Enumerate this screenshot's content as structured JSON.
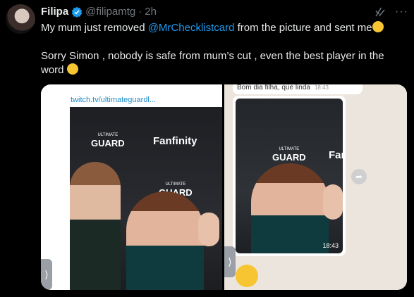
{
  "tweet": {
    "author": {
      "name": "Filipa",
      "handle": "@filipamtg",
      "dot": "·",
      "time": "2h"
    },
    "text": {
      "line1_before": "My mum just removed ",
      "mention": "@MrChecklistcard",
      "line1_after": " from the picture and sent  me",
      "line2": "Sorry Simon , nobody is safe from mum’s cut , even the best player in the word"
    },
    "icons": {
      "verified": "verified-badge-icon",
      "grok": "grok-icon",
      "more": "more-icon"
    }
  },
  "media": {
    "left": {
      "link": "twitch.tv/ultimateguardl...",
      "brand_logo": "ULTIMATE GUARD",
      "brand_logo_top": "ULTIMATE",
      "brand_logo_main": "GUARD",
      "sponsor": "Fanfinity",
      "arrow": "⟩"
    },
    "right": {
      "chat_text": "Bom dia filha, que linda",
      "chat_time": "18:43",
      "photo_time": "18:43",
      "brand_logo_top": "ULTIMATE",
      "brand_logo_main": "GUARD",
      "sponsor": "Fan",
      "arrow": "⟩",
      "forward": "➦"
    }
  },
  "colors": {
    "background": "#000000",
    "link": "#1d9bf0",
    "secondary": "#71767b"
  }
}
